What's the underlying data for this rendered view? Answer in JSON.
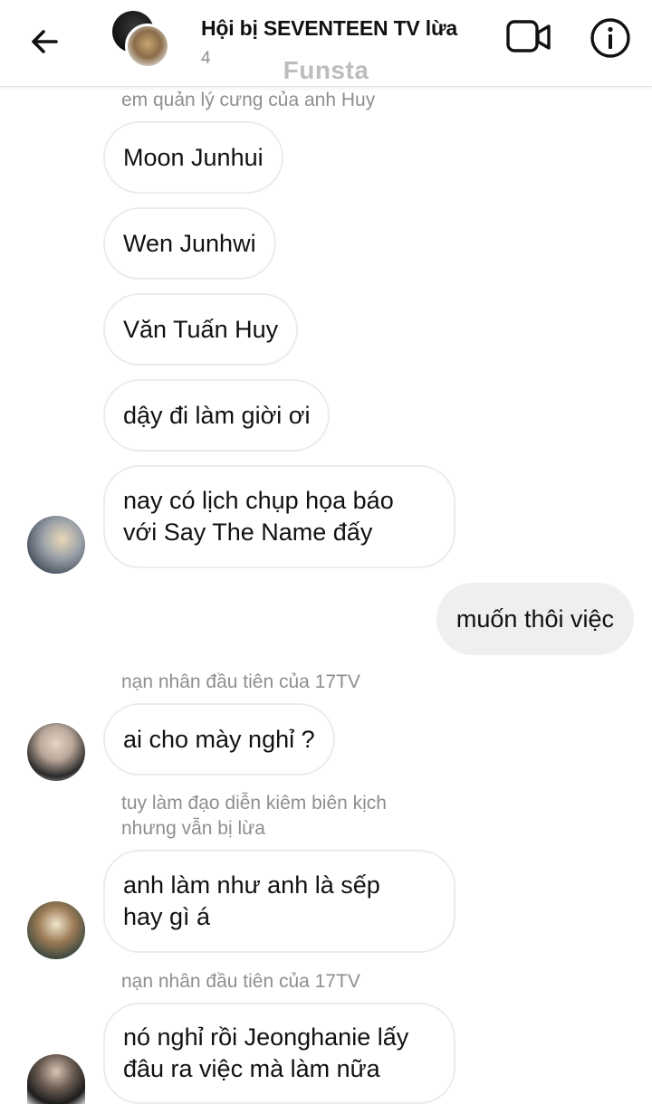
{
  "header": {
    "back_icon": "arrow-left-icon",
    "title": "Hội bị SEVENTEEN TV lừa",
    "member_count": "4",
    "watermark": "Funsta",
    "video_icon": "video-camera-icon",
    "info_icon": "info-circle-icon"
  },
  "messages": [
    {
      "label": "em quản lý cưng của anh Huy"
    },
    {
      "text": "Moon Junhui"
    },
    {
      "text": "Wen Junhwi"
    },
    {
      "text": "Văn Tuấn Huy"
    },
    {
      "text": "dậy đi làm giời ơi"
    },
    {
      "text": "nay có lịch chụp họa báo\nvới Say The Name đấy"
    },
    {
      "text": "muốn thôi việc"
    },
    {
      "label": "nạn nhân đầu tiên của 17TV"
    },
    {
      "text": "ai cho mày nghỉ ?"
    },
    {
      "label": "tuy làm đạo diễn kiêm biên kịch\nnhưng vẫn bị lừa"
    },
    {
      "text": "anh làm như anh là sếp\nhay gì á"
    },
    {
      "label": "nạn nhân đầu tiên của 17TV"
    },
    {
      "text": "nó nghỉ rồi Jeonghanie lấy\nđâu ra việc mà làm nữa"
    }
  ]
}
